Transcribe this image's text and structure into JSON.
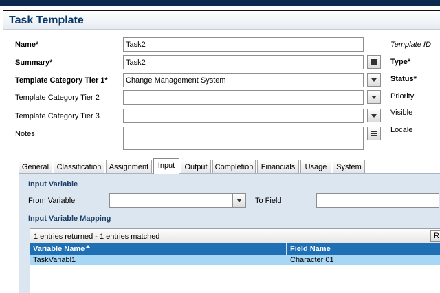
{
  "title": "Task Template",
  "form": {
    "name_label": "Name*",
    "name_value": "Task2",
    "summary_label": "Summary*",
    "summary_value": "Task2",
    "tier1_label": "Template Category Tier 1*",
    "tier1_value": "Change Management System",
    "tier2_label": "Template Category Tier 2",
    "tier2_value": "",
    "tier3_label": "Template Category Tier 3",
    "tier3_value": "",
    "notes_label": "Notes",
    "notes_value": ""
  },
  "right_labels": {
    "template_id": "Template ID",
    "type": "Type*",
    "status": "Status*",
    "priority": "Priority",
    "visible": "Visible",
    "locale": "Locale"
  },
  "tabs": [
    "General",
    "Classification",
    "Assignment",
    "Input",
    "Output",
    "Completion",
    "Financials",
    "Usage",
    "System"
  ],
  "active_tab": "Input",
  "input_panel": {
    "section1_title": "Input Variable",
    "from_variable_label": "From Variable",
    "from_variable_value": "",
    "to_field_label": "To Field",
    "to_field_value": "",
    "section2_title": "Input Variable Mapping"
  },
  "mapping_table": {
    "status": "1 entries returned - 1 entries matched",
    "button_label": "R",
    "columns": [
      "Variable Name",
      "Field Name"
    ],
    "rows": [
      [
        "TaskVariabl1",
        "Character 01"
      ]
    ]
  },
  "icons": {
    "text_menu": "menu-lines-icon",
    "dropdown": "dropdown-arrow-icon",
    "sort": "sort-ascending-icon"
  },
  "colors": {
    "title": "#0b3a6a",
    "panel_bg": "#dce6f0",
    "table_header": "#1f6fb5",
    "selected_row": "#a8d6f5"
  }
}
